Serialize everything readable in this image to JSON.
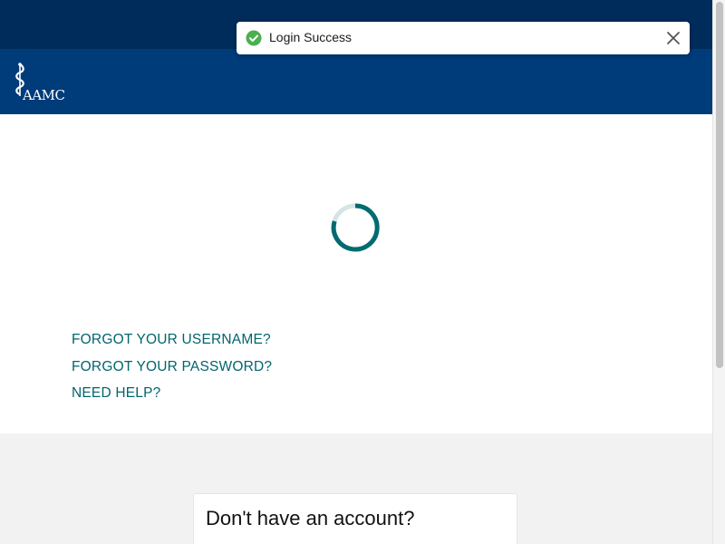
{
  "header": {
    "logo_text": "AAMC",
    "logo_icon": "caduceus-icon"
  },
  "notification": {
    "message": "Login Success",
    "status_icon": "check-circle-icon",
    "close_icon": "close-icon",
    "status_color": "#4caf50"
  },
  "main": {
    "loading_icon": "spinner-icon",
    "links": {
      "forgot_username": "FORGOT YOUR USERNAME?",
      "forgot_password": "FORGOT YOUR PASSWORD?",
      "need_help": "NEED HELP?"
    }
  },
  "signup_card": {
    "title": "Don't have an account?"
  },
  "colors": {
    "top_bar": "#002c5b",
    "header": "#003b7a",
    "link": "#00656d",
    "spinner": "#006b70"
  }
}
